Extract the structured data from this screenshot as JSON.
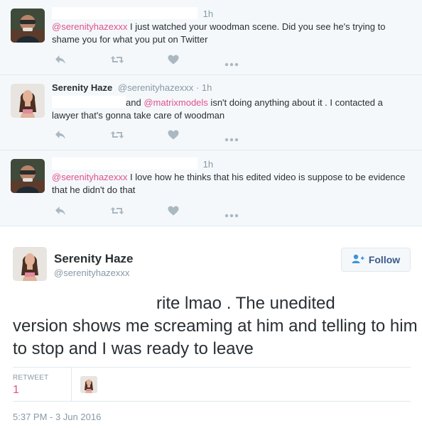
{
  "replies": [
    {
      "name": "",
      "time": "1h",
      "mention": "@serenityhazexxx",
      "text": " I just watched your woodman scene. Did you see he's trying to shame you for what you put on Twitter"
    },
    {
      "name": "Serenity Haze",
      "handle": "@serenityhazexxx",
      "sep": "·",
      "time": "1h",
      "text_pre": "and ",
      "mention": "@matrixmodels",
      "text_post": "  isn't doing anything about it . I contacted a lawyer that's gonna take care of woodman"
    },
    {
      "name": "",
      "time": "1h",
      "mention": "@serenityhazexxx",
      "text": " I love how he thinks that his edited video is suppose to be evidence that he didn't do that"
    }
  ],
  "main_tweet": {
    "name": "Serenity Haze",
    "handle": "@serenityhazexxx",
    "follow_label": "Follow",
    "text_line1": "rite lmao . The unedited",
    "text_rest": "version shows me screaming at him and telling to him to stop and I was ready to leave",
    "retweet_label": "RETWEET",
    "retweet_count": "1",
    "timestamp": "5:37 PM - 3 Jun 2016"
  },
  "icons": {
    "reply": "reply-icon",
    "retweet": "retweet-icon",
    "like": "heart-icon",
    "more": "more-icon",
    "follow": "follow-user-icon"
  },
  "colors": {
    "mention": "#e0518f",
    "muted": "#8899a6",
    "follow_text": "#3a5a8c",
    "reply_bg": "#f5f8fa"
  }
}
